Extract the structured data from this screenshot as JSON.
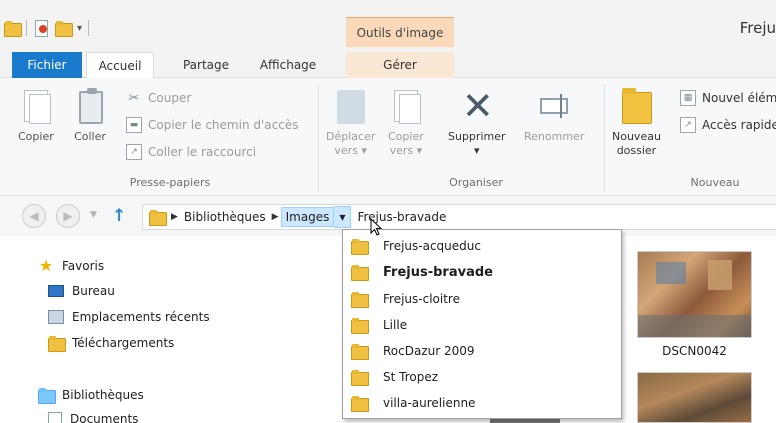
{
  "window": {
    "title": "Freju",
    "context_tab": "Outils d'image"
  },
  "ribbon_tabs": {
    "fichier": "Fichier",
    "accueil": "Accueil",
    "partage": "Partage",
    "affichage": "Affichage",
    "gerer": "Gérer"
  },
  "clipboard_group": {
    "label": "Presse-papiers",
    "copier": "Copier",
    "coller": "Coller",
    "couper": "Couper",
    "copier_chemin": "Copier le chemin d'accès",
    "coller_raccourci": "Coller le raccourci"
  },
  "organize_group": {
    "label": "Organiser",
    "deplacer": "Déplacer",
    "deplacer_sub": "vers",
    "copier": "Copier",
    "copier_sub": "vers",
    "supprimer": "Supprimer",
    "renommer": "Renommer"
  },
  "new_group": {
    "label": "Nouveau",
    "nouveau_dossier_1": "Nouveau",
    "nouveau_dossier_2": "dossier",
    "nouvel_element": "Nouvel élém",
    "acces_rapide": "Accès rapide"
  },
  "address": {
    "crumbs": [
      "Bibliothèques",
      "Images",
      "Frejus-bravade"
    ]
  },
  "nav_pane": {
    "favoris": "Favoris",
    "bureau": "Bureau",
    "emplacements": "Emplacements récents",
    "telechargements": "Téléchargements",
    "bibliotheques": "Bibliothèques",
    "documents": "Documents"
  },
  "content": {
    "thumb_label": "DSCN0042"
  },
  "dropdown": {
    "items": [
      "Frejus-acqueduc",
      "Frejus-bravade",
      "Frejus-cloitre",
      "Lille",
      "RocDazur 2009",
      "St Tropez",
      "villa-aurelienne"
    ],
    "selected": "Frejus-bravade"
  }
}
